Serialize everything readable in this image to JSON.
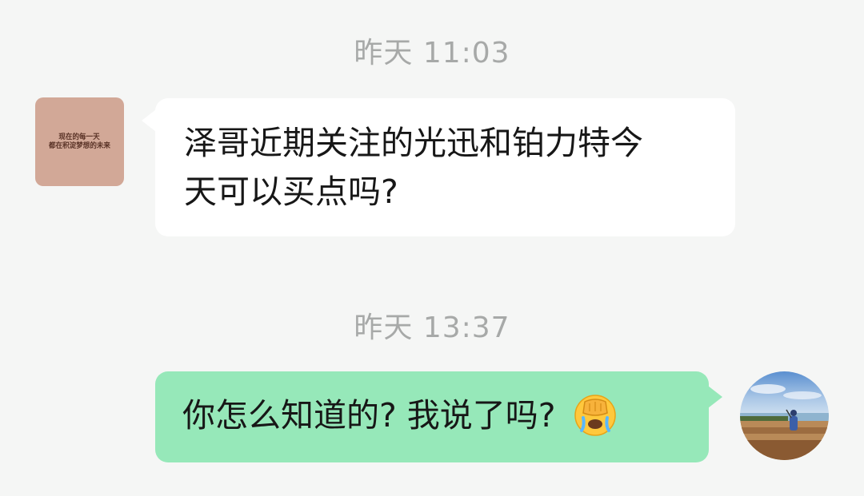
{
  "timestamps": {
    "first": "昨天 11:03",
    "second": "昨天 13:37"
  },
  "contact": {
    "avatar_text_line1": "现在的每一天",
    "avatar_text_line2": "都在积淀梦想的未来"
  },
  "messages": [
    {
      "direction": "incoming",
      "line1": "泽哥近期关注的光迅和铂力特今",
      "line2": "天可以买点吗?"
    },
    {
      "direction": "outgoing",
      "text": "你怎么知道的? 我说了吗?",
      "emoji": "face-palm-crying-emoji"
    }
  ],
  "colors": {
    "background": "#f5f6f5",
    "incoming_bubble": "#ffffff",
    "outgoing_bubble": "#96e8b9",
    "timestamp": "#a7a9a8"
  }
}
